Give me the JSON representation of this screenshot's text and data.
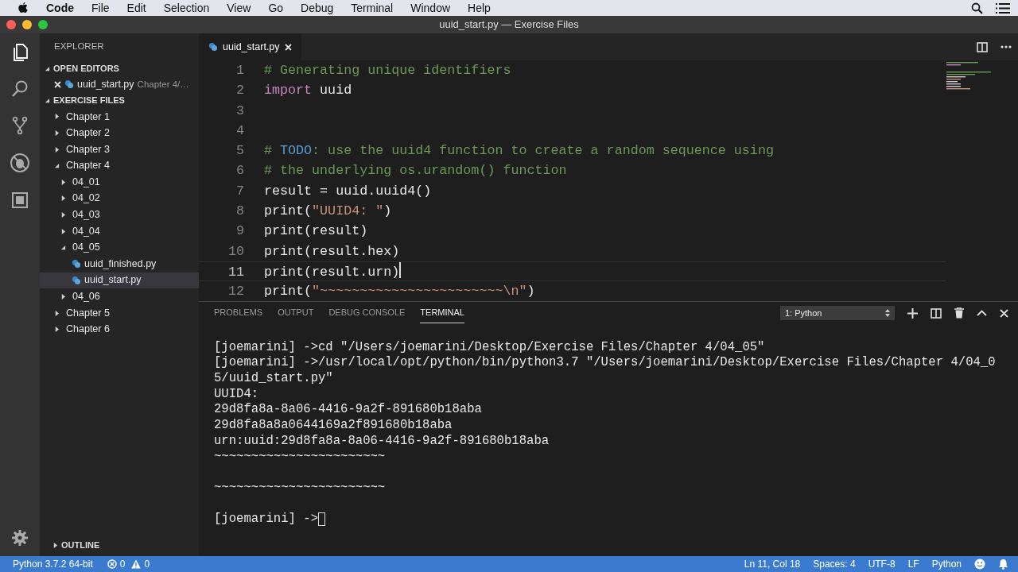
{
  "menubar": {
    "app_name": "Code",
    "menus": [
      "File",
      "Edit",
      "Selection",
      "View",
      "Go",
      "Debug",
      "Terminal",
      "Window",
      "Help"
    ]
  },
  "window": {
    "title": "uuid_start.py — Exercise Files"
  },
  "sidebar": {
    "title": "EXPLORER",
    "open_editors": {
      "title": "OPEN EDITORS",
      "expanded": true,
      "items": [
        {
          "name": "uuid_start.py",
          "description": "Chapter 4/…",
          "selected": false
        }
      ]
    },
    "files": {
      "title": "EXERCISE FILES",
      "expanded": true,
      "tree": [
        {
          "label": "Chapter 1",
          "kind": "folder",
          "expanded": false,
          "selected": false
        },
        {
          "label": "Chapter 2",
          "kind": "folder",
          "expanded": false,
          "selected": false
        },
        {
          "label": "Chapter 3",
          "kind": "folder",
          "expanded": false,
          "selected": false
        },
        {
          "label": "Chapter 4",
          "kind": "folder",
          "expanded": true,
          "selected": false,
          "children": [
            {
              "label": "04_01",
              "kind": "folder",
              "expanded": false,
              "selected": false
            },
            {
              "label": "04_02",
              "kind": "folder",
              "expanded": false,
              "selected": false
            },
            {
              "label": "04_03",
              "kind": "folder",
              "expanded": false,
              "selected": false
            },
            {
              "label": "04_04",
              "kind": "folder",
              "expanded": false,
              "selected": false
            },
            {
              "label": "04_05",
              "kind": "folder",
              "expanded": true,
              "selected": false,
              "children": [
                {
                  "label": "uuid_finished.py",
                  "kind": "file",
                  "selected": false
                },
                {
                  "label": "uuid_start.py",
                  "kind": "file",
                  "selected": true
                }
              ]
            },
            {
              "label": "04_06",
              "kind": "folder",
              "expanded": false,
              "selected": false
            }
          ]
        },
        {
          "label": "Chapter 5",
          "kind": "folder",
          "expanded": false,
          "selected": false
        },
        {
          "label": "Chapter 6",
          "kind": "folder",
          "expanded": false,
          "selected": false
        }
      ]
    },
    "outline": {
      "title": "OUTLINE",
      "expanded": false
    }
  },
  "editor": {
    "tabs": [
      {
        "label": "uuid_start.py",
        "selected": true
      }
    ],
    "lines": [
      {
        "number": "1",
        "current": false,
        "segments": [
          {
            "kind": "comment",
            "text": "# Generating unique identifiers"
          }
        ]
      },
      {
        "number": "2",
        "current": false,
        "segments": [
          {
            "kind": "keyword",
            "text": "import"
          },
          {
            "kind": "plain",
            "text": " uuid"
          }
        ]
      },
      {
        "number": "3",
        "current": false
      },
      {
        "number": "4",
        "current": false
      },
      {
        "number": "5",
        "current": false,
        "segments": [
          {
            "kind": "comment",
            "text": "# "
          },
          {
            "kind": "todo",
            "text": "TODO"
          },
          {
            "kind": "comment",
            "text": ": use the uuid4 function to create a random sequence using"
          }
        ]
      },
      {
        "number": "6",
        "current": false,
        "segments": [
          {
            "kind": "comment",
            "text": "# the underlying os.urandom() function"
          }
        ]
      },
      {
        "number": "7",
        "current": false,
        "segments": [
          {
            "kind": "plain",
            "text": "result = uuid.uuid4()"
          }
        ]
      },
      {
        "number": "8",
        "current": false,
        "segments": [
          {
            "kind": "plain",
            "text": "print("
          },
          {
            "kind": "string",
            "text": "\"UUID4: \""
          },
          {
            "kind": "plain",
            "text": ")"
          }
        ]
      },
      {
        "number": "9",
        "current": false,
        "segments": [
          {
            "kind": "plain",
            "text": "print(result)"
          }
        ]
      },
      {
        "number": "10",
        "current": false,
        "segments": [
          {
            "kind": "plain",
            "text": "print(result.hex)"
          }
        ]
      },
      {
        "number": "11",
        "current": true,
        "segments": [
          {
            "kind": "plain",
            "text": "print(result.urn)"
          }
        ]
      },
      {
        "number": "12",
        "current": false,
        "segments": [
          {
            "kind": "plain",
            "text": "print("
          },
          {
            "kind": "string",
            "text": "\"~~~~~~~~~~~~~~~~~~~~~~~\\n\""
          },
          {
            "kind": "plain",
            "text": ")"
          }
        ]
      }
    ]
  },
  "panel": {
    "tabs": [
      {
        "label": "PROBLEMS",
        "selected": false
      },
      {
        "label": "OUTPUT",
        "selected": false
      },
      {
        "label": "DEBUG CONSOLE",
        "selected": false
      },
      {
        "label": "TERMINAL",
        "selected": true
      }
    ],
    "terminal_select": "1: Python",
    "terminal": [
      {
        "kind": "blank"
      },
      {
        "kind": "output",
        "text": "[joemarini] ->cd \"/Users/joemarini/Desktop/Exercise Files/Chapter 4/04_05\""
      },
      {
        "kind": "output",
        "text": "[joemarini] ->/usr/local/opt/python/bin/python3.7 \"/Users/joemarini/Desktop/Exercise Files/Chapter 4/04_0"
      },
      {
        "kind": "output",
        "text": "5/uuid_start.py\""
      },
      {
        "kind": "output",
        "text": "UUID4:"
      },
      {
        "kind": "output",
        "text": "29d8fa8a-8a06-4416-9a2f-891680b18aba"
      },
      {
        "kind": "output",
        "text": "29d8fa8a8a0644169a2f891680b18aba"
      },
      {
        "kind": "output",
        "text": "urn:uuid:29d8fa8a-8a06-4416-9a2f-891680b18aba"
      },
      {
        "kind": "output",
        "text": "~~~~~~~~~~~~~~~~~~~~~~~"
      },
      {
        "kind": "blank"
      },
      {
        "kind": "output",
        "text": "~~~~~~~~~~~~~~~~~~~~~~~"
      },
      {
        "kind": "blank"
      },
      {
        "kind": "prompt",
        "text": "[joemarini] ->"
      }
    ]
  },
  "status_bar": {
    "left": [
      {
        "text": "Python 3.7.2 64-bit",
        "kind": "text"
      },
      {
        "text": "0",
        "kind": "errors"
      },
      {
        "text": "0",
        "kind": "warnings"
      }
    ],
    "right": [
      {
        "text": "Ln 11, Col 18",
        "kind": "text"
      },
      {
        "text": "Spaces: 4",
        "kind": "text"
      },
      {
        "text": "UTF-8",
        "kind": "text"
      },
      {
        "text": "LF",
        "kind": "text"
      },
      {
        "text": "Python",
        "kind": "text"
      }
    ]
  }
}
